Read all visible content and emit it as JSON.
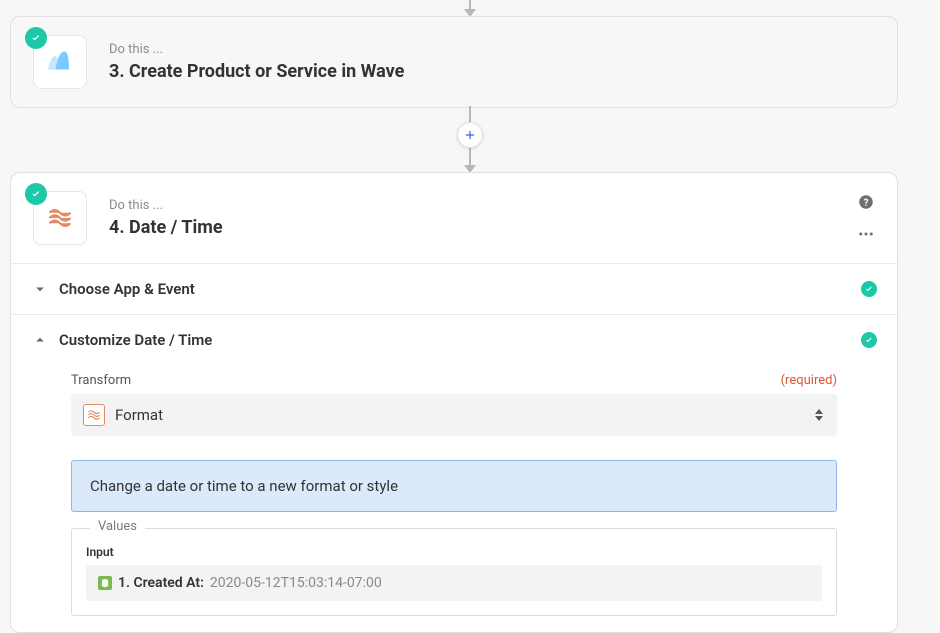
{
  "steps": {
    "step3": {
      "overline": "Do this ...",
      "title": "3. Create Product or Service in Wave"
    },
    "step4": {
      "overline": "Do this ...",
      "title": "4. Date / Time"
    }
  },
  "sections": {
    "choose_app": {
      "label": "Choose App & Event"
    },
    "customize": {
      "label": "Customize Date / Time"
    }
  },
  "customize": {
    "transform_label": "Transform",
    "required_label": "(required)",
    "transform_value": "Format",
    "banner": "Change a date or time to a new format or style",
    "values_legend": "Values",
    "input_label": "Input",
    "token_name": "1. Created At:",
    "token_value": "2020-05-12T15:03:14-07:00"
  }
}
